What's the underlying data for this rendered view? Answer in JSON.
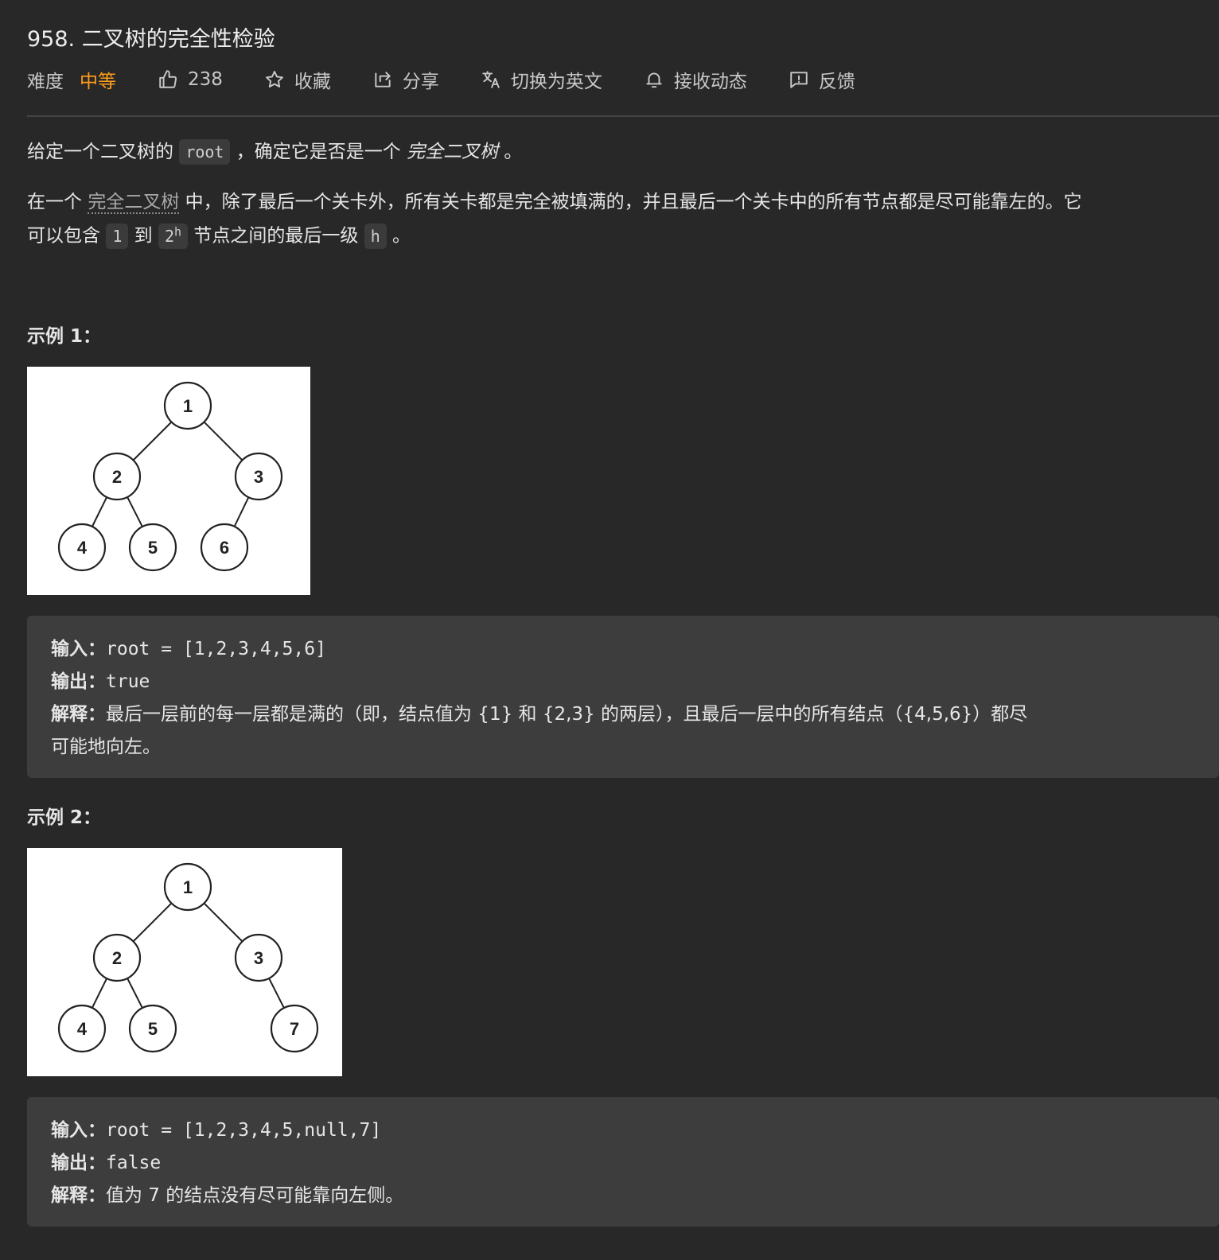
{
  "problem": {
    "title": "958. 二叉树的完全性检验",
    "difficulty_label": "难度",
    "difficulty_value": "中等",
    "likes": "238",
    "favorite": "收藏",
    "share": "分享",
    "translate": "切换为英文",
    "subscribe": "接收动态",
    "feedback": "反馈"
  },
  "colors": {
    "background": "#282828",
    "difficulty_medium": "#ff9e1b",
    "code_bg": "#3b3b3b",
    "example_bg": "#3d3d3d"
  },
  "description": {
    "p1_prefix": "给定一个二叉树的",
    "p1_code": "root",
    "p1_middle": "，确定它是否是一个",
    "p1_em": "完全二叉树",
    "p1_suffix": "。",
    "p2_line1_prefix": "在一个",
    "p2_link": "完全二叉树",
    "p2_line1_suffix": "中，除了最后一个关卡外，所有关卡都是完全被填满的，并且最后一个关卡中的所有节点都是尽可能靠左的。它",
    "p2_line2_prefix": "可以包含",
    "p2_code1": "1",
    "p2_to": "到",
    "p2_code2_base": "2",
    "p2_code2_sup": "h",
    "p2_line2_middle": "节点之间的最后一级",
    "p2_code3": "h",
    "p2_line2_suffix": "。"
  },
  "examples": [
    {
      "heading": "示例 1：",
      "tree_nodes": [
        "1",
        "2",
        "3",
        "4",
        "5",
        "6"
      ],
      "input_label": "输入：",
      "input_value": "root = [1,2,3,4,5,6]",
      "output_label": "输出：",
      "output_value": "true",
      "explain_label": "解释：",
      "explain_line1": "最后一层前的每一层都是满的（即，结点值为 {1} 和 {2,3} 的两层），且最后一层中的所有结点（{4,5,6}）都尽",
      "explain_line2": "可能地向左。"
    },
    {
      "heading": "示例 2：",
      "tree_nodes": [
        "1",
        "2",
        "3",
        "4",
        "5",
        "7"
      ],
      "input_label": "输入：",
      "input_value": "root = [1,2,3,4,5,null,7]",
      "output_label": "输出：",
      "output_value": "false",
      "explain_label": "解释：",
      "explain_line1": "值为 7 的结点没有尽可能靠向左侧。"
    }
  ]
}
